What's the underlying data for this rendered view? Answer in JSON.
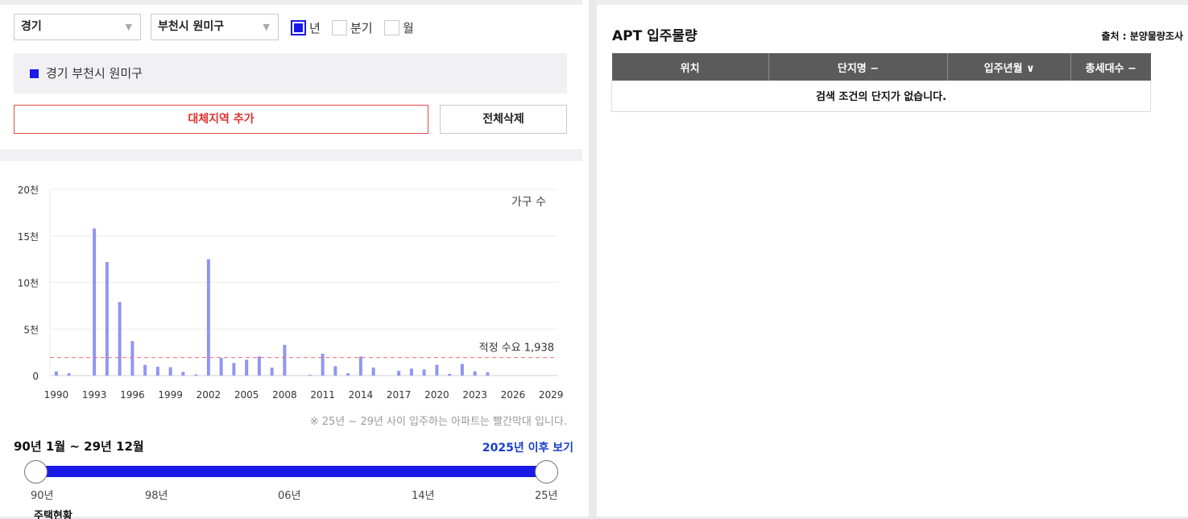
{
  "filters": {
    "province": "경기",
    "district": "부천시 원미구",
    "periods": [
      {
        "label": "년",
        "checked": true
      },
      {
        "label": "분기",
        "checked": false
      },
      {
        "label": "월",
        "checked": false
      }
    ]
  },
  "selected_region": "경기 부천시 원미구",
  "buttons": {
    "add_region": "대체지역 추가",
    "delete_all": "전체삭제"
  },
  "chart_data": {
    "type": "bar",
    "series_label": "가구 수",
    "ylabel_ticks": [
      "0",
      "5천",
      "10천",
      "15천",
      "20천"
    ],
    "y_tick_values": [
      0,
      5000,
      10000,
      15000,
      20000
    ],
    "ylim": [
      0,
      20000
    ],
    "x_tick_labels": [
      "1990",
      "1993",
      "1996",
      "1999",
      "2002",
      "2005",
      "2008",
      "2011",
      "2014",
      "2017",
      "2020",
      "2023",
      "2026",
      "2029"
    ],
    "x_tick_values": [
      1990,
      1993,
      1996,
      1999,
      2002,
      2005,
      2008,
      2011,
      2014,
      2017,
      2020,
      2023,
      2026,
      2029
    ],
    "xlim": [
      1989.5,
      2029.5
    ],
    "bar_color": "#8f96f2",
    "years": [
      1990,
      1991,
      1992,
      1993,
      1994,
      1995,
      1996,
      1997,
      1998,
      1999,
      2000,
      2001,
      2002,
      2003,
      2004,
      2005,
      2006,
      2007,
      2008,
      2009,
      2010,
      2011,
      2012,
      2013,
      2014,
      2015,
      2016,
      2017,
      2018,
      2019,
      2020,
      2021,
      2022,
      2023,
      2024,
      2025,
      2026,
      2027,
      2028,
      2029
    ],
    "values": [
      450,
      250,
      0,
      15800,
      12200,
      7900,
      3700,
      1150,
      950,
      900,
      400,
      120,
      12500,
      1900,
      1350,
      1700,
      2050,
      850,
      3300,
      0,
      80,
      2350,
      1000,
      250,
      2050,
      850,
      0,
      500,
      750,
      650,
      1150,
      180,
      1250,
      450,
      350,
      0,
      0,
      0,
      0,
      0
    ],
    "reference_line": {
      "label": "적정 수요 1,938",
      "value": 1938,
      "color": "#ef6b6b"
    }
  },
  "note": "※ 25년 ~ 29년 사이 입주하는 아파트는 빨간막대 입니다.",
  "range": {
    "title": "90년 1월 ~ 29년 12월",
    "after_link": "2025년 이후 보기",
    "ticks": [
      "90년",
      "98년",
      "06년",
      "14년",
      "25년"
    ],
    "slider_color": "#1a1ae6"
  },
  "peek_text": "주택현황",
  "right": {
    "title": "APT 입주물량",
    "source": "출처 : 분양물량조사",
    "columns": [
      "위치",
      "단지명 −",
      "입주년월 ∨",
      "총세대수 −"
    ],
    "empty_message": "검색 조건의 단지가 없습니다."
  }
}
